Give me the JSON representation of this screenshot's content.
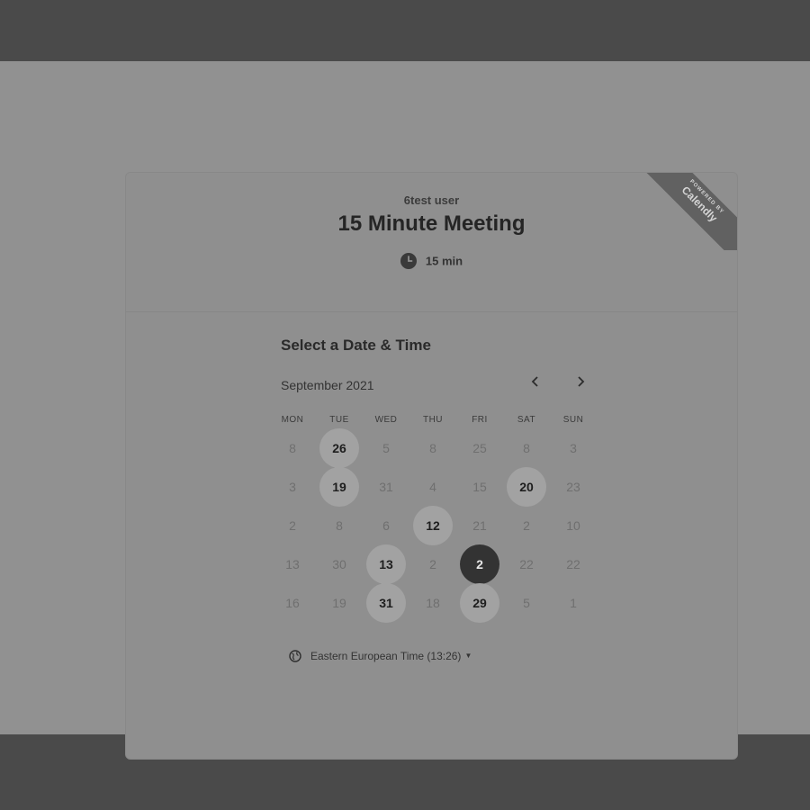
{
  "event": {
    "owner": "6test user",
    "title": "15 Minute Meeting",
    "duration": "15 min"
  },
  "badge": {
    "small": "POWERED BY",
    "brand": "Calendly"
  },
  "picker": {
    "title": "Select a Date & Time",
    "month": "September 2021",
    "prev_icon": "chevron-left-icon",
    "next_icon": "chevron-right-icon",
    "weekdays": [
      "MON",
      "TUE",
      "WED",
      "THU",
      "FRI",
      "SAT",
      "SUN"
    ],
    "rows": [
      [
        {
          "d": "8",
          "s": "u"
        },
        {
          "d": "26",
          "s": "a"
        },
        {
          "d": "5",
          "s": "u"
        },
        {
          "d": "8",
          "s": "u"
        },
        {
          "d": "25",
          "s": "u"
        },
        {
          "d": "8",
          "s": "u"
        },
        {
          "d": "3",
          "s": "u"
        }
      ],
      [
        {
          "d": "3",
          "s": "u"
        },
        {
          "d": "19",
          "s": "a"
        },
        {
          "d": "31",
          "s": "u"
        },
        {
          "d": "4",
          "s": "u"
        },
        {
          "d": "15",
          "s": "u"
        },
        {
          "d": "20",
          "s": "a"
        },
        {
          "d": "23",
          "s": "u"
        }
      ],
      [
        {
          "d": "2",
          "s": "u"
        },
        {
          "d": "8",
          "s": "u"
        },
        {
          "d": "6",
          "s": "u"
        },
        {
          "d": "12",
          "s": "a"
        },
        {
          "d": "21",
          "s": "u"
        },
        {
          "d": "2",
          "s": "u"
        },
        {
          "d": "10",
          "s": "u"
        }
      ],
      [
        {
          "d": "13",
          "s": "u"
        },
        {
          "d": "30",
          "s": "u"
        },
        {
          "d": "13",
          "s": "a"
        },
        {
          "d": "2",
          "s": "u"
        },
        {
          "d": "2",
          "s": "sel"
        },
        {
          "d": "22",
          "s": "u"
        },
        {
          "d": "22",
          "s": "u"
        }
      ],
      [
        {
          "d": "16",
          "s": "u"
        },
        {
          "d": "19",
          "s": "u"
        },
        {
          "d": "31",
          "s": "a"
        },
        {
          "d": "18",
          "s": "u"
        },
        {
          "d": "29",
          "s": "a"
        },
        {
          "d": "5",
          "s": "u"
        },
        {
          "d": "1",
          "s": "u"
        }
      ]
    ]
  },
  "timezone": {
    "label": "Eastern European Time (13:26)",
    "icon": "globe-icon"
  }
}
